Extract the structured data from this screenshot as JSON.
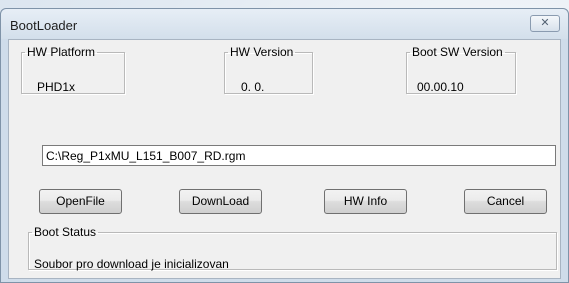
{
  "window": {
    "title": "BootLoader"
  },
  "hw_platform": {
    "label": "HW Platform",
    "value": "PHD1x"
  },
  "hw_version": {
    "label": "HW Version",
    "value": "0. 0."
  },
  "boot_sw_version": {
    "label": "Boot SW Version",
    "value": "00.00.10"
  },
  "file_path": {
    "value": "C:\\Reg_P1xMU_L151_B007_RD.rgm"
  },
  "buttons": {
    "open_file": "OpenFile",
    "download": "DownLoad",
    "hw_info": "HW Info",
    "cancel": "Cancel"
  },
  "boot_status": {
    "label": "Boot Status",
    "message": "Soubor pro download je inicializovan"
  },
  "icons": {
    "close": "close-icon"
  }
}
